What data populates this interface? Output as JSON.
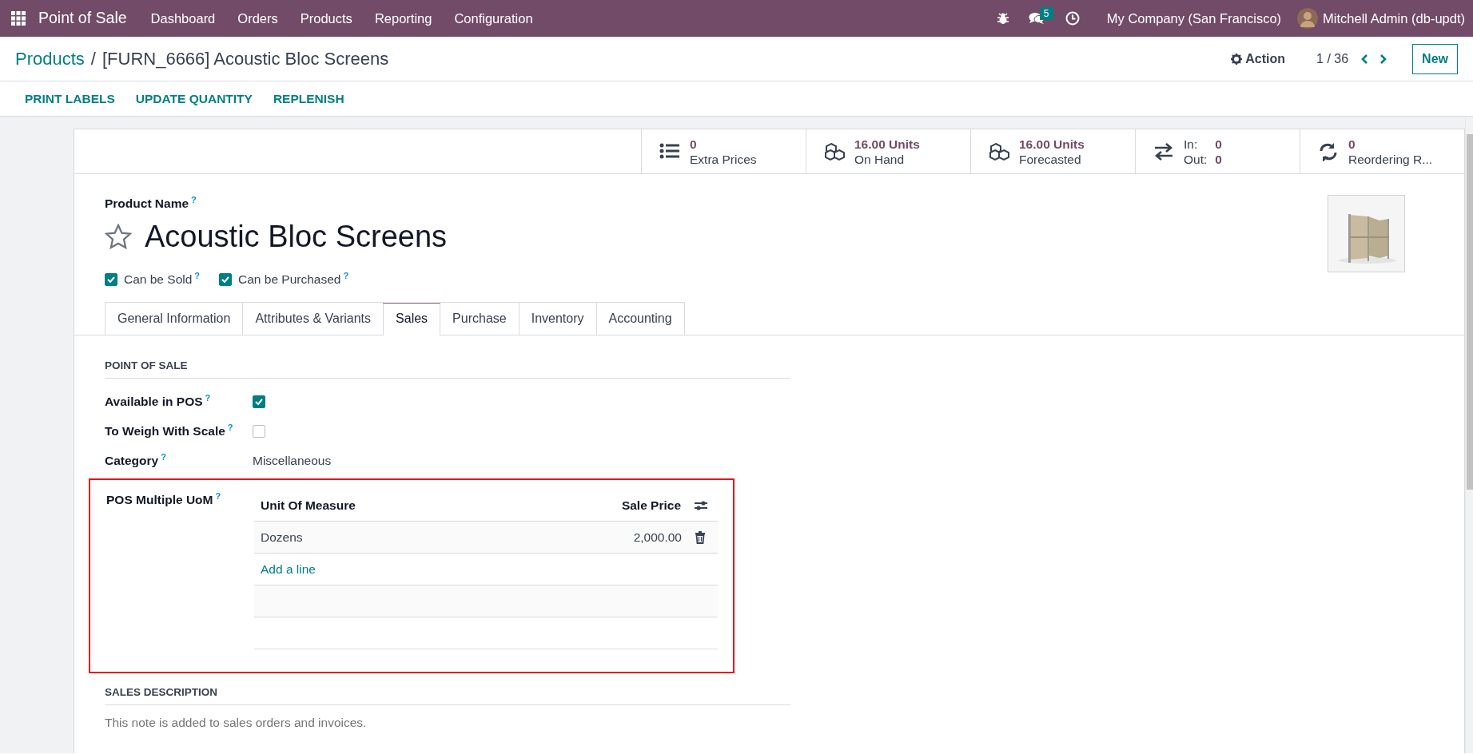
{
  "navbar": {
    "app_name": "Point of Sale",
    "menu": [
      "Dashboard",
      "Orders",
      "Products",
      "Reporting",
      "Configuration"
    ],
    "messages_count": "5",
    "company": "My Company (San Francisco)",
    "user": "Mitchell Admin (db-updt)"
  },
  "breadcrumb": {
    "parent": "Products",
    "separator": "/",
    "current": "[FURN_6666] Acoustic Bloc Screens"
  },
  "control_panel": {
    "action": "Action",
    "pager": "1 / 36",
    "new_button": "New"
  },
  "action_buttons": [
    "PRINT LABELS",
    "UPDATE QUANTITY",
    "REPLENISH"
  ],
  "stat_buttons": [
    {
      "kind": "list",
      "value": "0",
      "label": "Extra Prices"
    },
    {
      "kind": "cubes",
      "value": "16.00 Units",
      "label": "On Hand"
    },
    {
      "kind": "cubes",
      "value": "16.00 Units",
      "label": "Forecasted"
    },
    {
      "kind": "in_out",
      "in_label": "In:",
      "in_value": "0",
      "out_label": "Out:",
      "out_value": "0"
    },
    {
      "kind": "refresh",
      "value": "0",
      "label": "Reordering R..."
    }
  ],
  "product": {
    "name_label": "Product Name",
    "help": "?",
    "name": "Acoustic Bloc Screens",
    "favorite": false,
    "options": [
      {
        "label": "Can be Sold",
        "help": "?",
        "checked": true
      },
      {
        "label": "Can be Purchased",
        "help": "?",
        "checked": true
      }
    ]
  },
  "tabs": [
    {
      "label": "General Information",
      "selected": false
    },
    {
      "label": "Attributes & Variants",
      "selected": false
    },
    {
      "label": "Sales",
      "selected": true
    },
    {
      "label": "Purchase",
      "selected": false
    },
    {
      "label": "Inventory",
      "selected": false
    },
    {
      "label": "Accounting",
      "selected": false
    }
  ],
  "point_of_sale": {
    "title": "POINT OF SALE",
    "fields": [
      {
        "kind": "checkbox",
        "label": "Available in POS",
        "help": "?",
        "checked": true
      },
      {
        "kind": "checkbox",
        "label": "To Weigh With Scale",
        "help": "?",
        "checked": false
      },
      {
        "kind": "text",
        "label": "Category",
        "help": "?",
        "value": "Miscellaneous"
      }
    ]
  },
  "pos_multiple_uom": {
    "label": "POS Multiple UoM",
    "help": "?",
    "highlighted": true,
    "columns": [
      "Unit Of Measure",
      "Sale Price"
    ],
    "rows": [
      {
        "unit": "Dozens",
        "price": "2,000.00"
      }
    ],
    "add_line": "Add a line"
  },
  "sales_description": {
    "title": "SALES DESCRIPTION",
    "placeholder": "This note is added to sales orders and invoices."
  }
}
